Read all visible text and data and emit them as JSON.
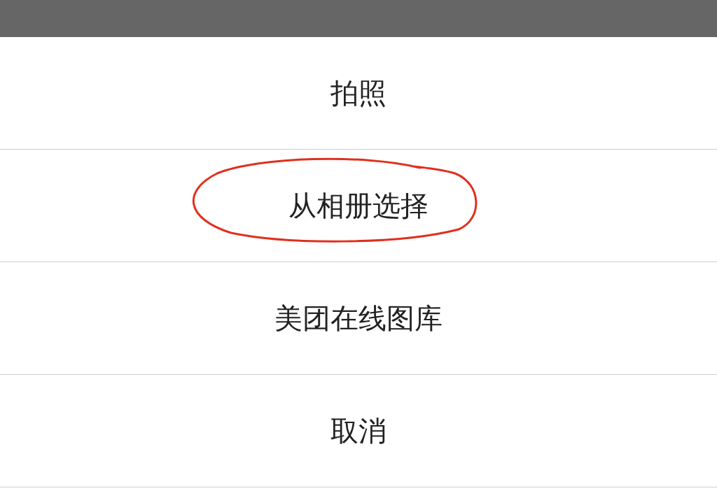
{
  "action_sheet": {
    "items": [
      {
        "label": "拍照",
        "circled": false
      },
      {
        "label": "从相册选择",
        "circled": true
      },
      {
        "label": "美团在线图库",
        "circled": false
      },
      {
        "label": "取消",
        "circled": false
      }
    ]
  }
}
